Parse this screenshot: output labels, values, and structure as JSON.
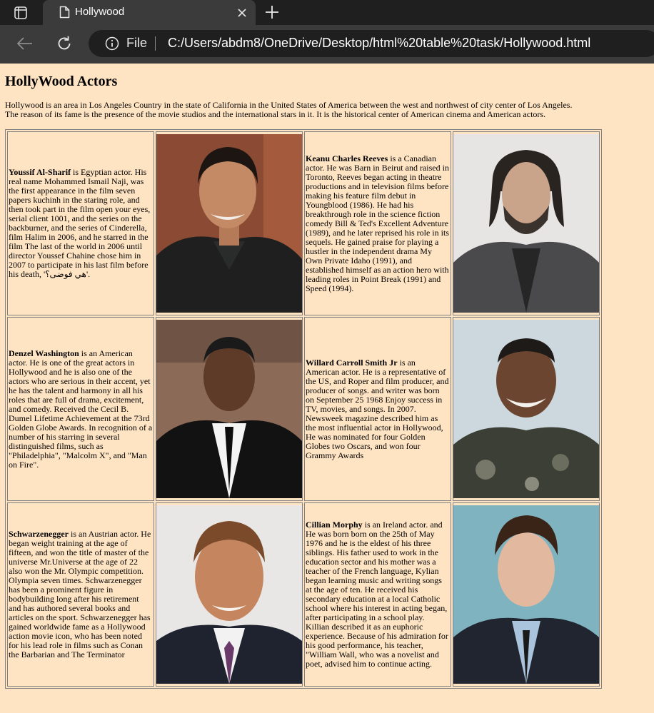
{
  "browser": {
    "tab_title": "Hollywood",
    "address_scheme": "File",
    "address_url": "C:/Users/abdm8/OneDrive/Desktop/html%20table%20task/Hollywood.html",
    "icons": [
      "tab-actions-icon",
      "page-icon",
      "close-icon",
      "plus-icon",
      "back-arrow-icon",
      "reload-icon",
      "info-icon"
    ]
  },
  "page": {
    "heading": "HollyWood Actors",
    "intro_line1": "Hollywood is an area in Los Angeles Country in the state of California in the United States of America between the west and northwest of city center of Los Angeles.",
    "intro_line2": "The reason of its fame is the presence of the movie studios and the international stars in it. It is the historical center of American cinema and American actors."
  },
  "actors": [
    {
      "name": "Youssif Al-Sharif",
      "bio": " is Egyptian actor. His real name Mohammed Ismail Naji, was the first appearance in the film seven papers kuchinh in the staring role, and then took part in the film open your eyes, serial client 1001, and the series on the backburner, and the series of Cinderella, film Halim in 2006, and he starred in the film The last of the world in 2006 until director Youssef Chahine chose him in 2007 to participate in his last film before his death, 'هي فوضى؟'."
    },
    {
      "name": "Keanu Charles Reeves",
      "bio": " is a Canadian actor. He was Barn in Beirut and raised in Toronto, Reeves began acting in theatre productions and in television films before making his feature film debut in Youngblood (1986). He had his breakthrough role in the science fiction comedy Bill & Ted's Excellent Adventure (1989), and he later reprised his role in its sequels. He gained praise for playing a hustler in the independent drama My Own Private Idaho (1991), and established himself as an action hero with leading roles in Point Break (1991) and Speed (1994)."
    },
    {
      "name": "Denzel Washington",
      "bio": " is an American actor. He is one of the great actors in Hollywood and he is also one of the actors who are serious in their accent, yet he has the talent and harmony in all his roles that are full of drama, excitement, and comedy. Received the Cecil B. Dumel Lifetime Achievement at the 73rd Golden Globe Awards. In recognition of a number of his starring in several distinguished films, such as \"Philadelphia\", \"Malcolm X\", and \"Man on Fire\"."
    },
    {
      "name": "Willard Carroll Smith Jr",
      "bio": " is an American actor. He is a representative of the US, and Roper and film producer, and producer of songs. and writer was born on September 25 1968 Enjoy success in TV, movies, and songs. In 2007. Newsweek magazine described him as the most influential actor in Hollywood, He was nominated for four Golden Globes two Oscars, and won four Grammy Awards"
    },
    {
      "name": "Schwarzenegger",
      "bio": " is an Austrian actor. He began weight training at the age of fifteen, and won the title of master of the universe Mr.Universe at the age of 22 also won the Mr. Olympic competition. Olympia seven times. Schwarzenegger has been a prominent figure in bodybuilding long after his retirement and has authored several books and articles on the sport. Schwarzenegger has gained worldwide fame as a Hollywood action movie icon, who has been noted for his lead role in films such as Conan the Barbarian and The Terminator"
    },
    {
      "name": "Cillian Morphy",
      "bio": " is an Ireland actor. and He was born born on the 25th of May 1976 and he is the eldest of his three siblings. His father used to work in the education sector and his mother was a teacher of the French language, Kylian began learning music and writing songs at the age of ten. He received his secondary education at a local Catholic school where his interest in acting began, after participating in a school play. Killian described it as an euphoric experience. Because of his admiration for his good performance, his teacher, \"William Wall, who was a novelist and poet, advised him to continue acting."
    }
  ],
  "colors": {
    "page_background": "#ffe4c4",
    "chrome_dark": "#1f1f1f",
    "chrome_mid": "#3b3b3b",
    "table_border": "#808080"
  }
}
